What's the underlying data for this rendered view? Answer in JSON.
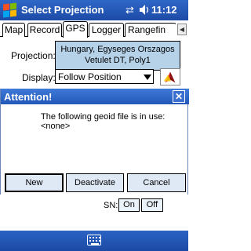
{
  "titlebar": {
    "title": "Select Projection",
    "time": "11:12",
    "sync_icon": "sync-arrows-icon",
    "speaker_icon": "speaker-icon"
  },
  "tabs": [
    {
      "label": "Map",
      "active": false
    },
    {
      "label": "Record",
      "active": false
    },
    {
      "label": "GPS",
      "active": true
    },
    {
      "label": "Logger",
      "active": false
    },
    {
      "label": "Rangefin",
      "active": false
    }
  ],
  "projection": {
    "label": "Projection:",
    "value_line1": "Hungary, Egyseges Orszagos",
    "value_line2": "Vetulet DT, Poly1"
  },
  "display": {
    "label": "Display:",
    "value": "Follow Position"
  },
  "dialog": {
    "title": "Attention!",
    "message_line1": "The following geoid file is in use:",
    "message_line2": "<none>",
    "buttons": {
      "new": "New",
      "deactivate": "Deactivate",
      "cancel": "Cancel"
    }
  },
  "sn": {
    "label": "SN:",
    "on": "On",
    "off": "Off"
  },
  "colors": {
    "titlebar": "#2a5fc0",
    "dialog_title": "#3170d0",
    "projection_box": "#b6d2e9",
    "button_bg": "#dfe9f5"
  }
}
